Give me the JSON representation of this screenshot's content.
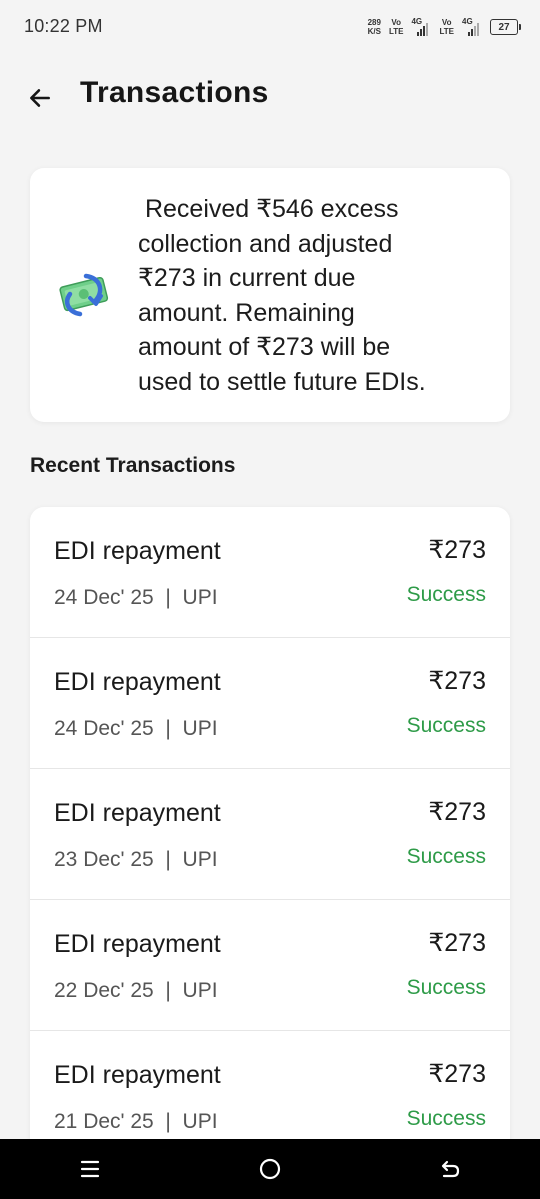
{
  "status_bar": {
    "time": "10:22 PM",
    "net_speed_value": "289",
    "net_speed_unit": "K/S",
    "sim1_vo": "Vo",
    "sim1_lte": "LTE",
    "sim1_net": "4G",
    "sim2_vo": "Vo",
    "sim2_lte": "LTE",
    "sim2_net": "4G",
    "battery_level": "27"
  },
  "header": {
    "title": "Transactions",
    "back_icon": "arrow-left-icon"
  },
  "info_card": {
    "icon": "money-refund-icon",
    "message": " Received ₹546 excess\ncollection and adjusted\n₹273 in current due\namount. Remaining\namount of ₹273 will be\nused to settle future EDIs."
  },
  "recent": {
    "title": "Recent Transactions",
    "items": [
      {
        "title": "EDI repayment",
        "meta": "24 Dec' 25  |  UPI",
        "amount": "₹273",
        "status": "Success"
      },
      {
        "title": "EDI repayment",
        "meta": "24 Dec' 25  |  UPI",
        "amount": "₹273",
        "status": "Success"
      },
      {
        "title": "EDI repayment",
        "meta": "23 Dec' 25  |  UPI",
        "amount": "₹273",
        "status": "Success"
      },
      {
        "title": "EDI repayment",
        "meta": "22 Dec' 25  |  UPI",
        "amount": "₹273",
        "status": "Success"
      },
      {
        "title": "EDI repayment",
        "meta": "21 Dec' 25  |  UPI",
        "amount": "₹273",
        "status": "Success"
      }
    ]
  },
  "colors": {
    "success": "#2e9b48",
    "background": "#f4f4f4",
    "card": "#ffffff"
  },
  "nav": {
    "recents_icon": "recents-icon",
    "home_icon": "home-circle-icon",
    "back_icon": "back-return-icon"
  }
}
